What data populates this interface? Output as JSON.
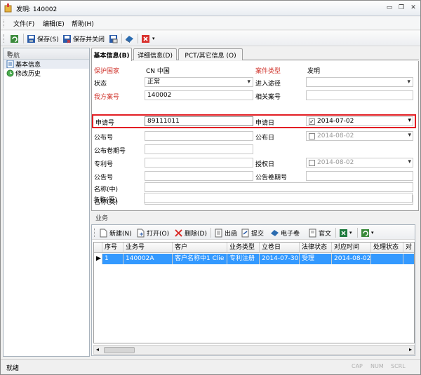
{
  "window": {
    "title": "发明: 140002"
  },
  "menu": {
    "file": "文件(F)",
    "edit": "编辑(E)",
    "help": "帮助(H)"
  },
  "toolbar": {
    "save": "保存(S)",
    "save_close": "保存并关闭"
  },
  "nav": {
    "title": "导航",
    "pin": "ᵽ",
    "items": [
      "基本信息",
      "修改历史"
    ]
  },
  "tabs": [
    "基本信息(B)",
    "详细信息(D)",
    "PCT/其它信息 (O)"
  ],
  "form": {
    "country_label": "保护国家",
    "country_value": "CN 中国",
    "case_type_label": "案件类型",
    "case_type_value": "发明",
    "status_label": "状态",
    "status_value": "正常",
    "entry_label": "进入途径",
    "entry_value": "",
    "our_ref_label": "我方案号",
    "our_ref_value": "140002",
    "related_label": "相关案号",
    "related_value": "",
    "app_no_label": "申请号",
    "app_no_value": "89111011",
    "app_date_label": "申请日",
    "app_date_value": "2014-07-02",
    "pub_no_label": "公布号",
    "pub_no_value": "",
    "pub_date_label": "公布日",
    "pub_date_value": "2014-08-02",
    "pub_vol_label": "公布卷期号",
    "pub_vol_value": "",
    "patent_no_label": "专利号",
    "patent_no_value": "",
    "grant_date_label": "授权日",
    "grant_date_value": "2014-08-02",
    "ann_no_label": "公告号",
    "ann_no_value": "",
    "ann_vol_label": "公告卷期号",
    "ann_vol_value": "",
    "name_cn_label": "名称(中)",
    "name_en_label": "名称(英)",
    "name_orig_label": "名称(原)"
  },
  "business": {
    "title": "业务",
    "toolbar": {
      "new": "新建(N)",
      "open": "打开(O)",
      "delete": "删除(D)",
      "outgoing": "出函",
      "submit": "提交",
      "efile": "电子卷",
      "official": "官文"
    },
    "columns": [
      "序号",
      "业务号",
      "客户",
      "业务类型",
      "立卷日",
      "法律状态",
      "对应时间",
      "处理状态",
      "对"
    ],
    "rows": [
      [
        "1",
        "140002A",
        "客户名称中1 Clie",
        "专利注册",
        "2014-07-30",
        "受理",
        "2014-08-02",
        "",
        ""
      ]
    ]
  },
  "status": {
    "text": "就绪",
    "cap": "CAP",
    "num": "NUM",
    "scrl": "SCRL"
  }
}
